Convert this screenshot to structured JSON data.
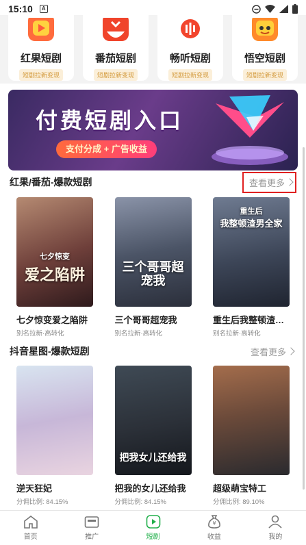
{
  "status": {
    "time": "15:10",
    "app_badge": "A"
  },
  "apps": [
    {
      "name": "红果短剧",
      "tag": "短剧拉新变现",
      "icon": "play-icon",
      "color": "#ff5a3c"
    },
    {
      "name": "番茄短剧",
      "tag": "短剧拉新变现",
      "icon": "tomato-icon",
      "color": "#f0442b"
    },
    {
      "name": "畅听短剧",
      "tag": "短剧拉新变现",
      "icon": "audio-icon",
      "color": "#f2452d"
    },
    {
      "name": "悟空短剧",
      "tag": "短剧拉新变现",
      "icon": "wukong-icon",
      "color": "#ff8a2a"
    }
  ],
  "banner": {
    "title": "付费短剧入口",
    "subtitle": "支付分成 + 广告收益"
  },
  "sections": [
    {
      "title": "红果/番茄-爆款短剧",
      "more": "查看更多",
      "items": [
        {
          "title": "七夕惊变爱之陷阱",
          "sub": "别名拉新·高转化",
          "poster_text": "爱之陷阱",
          "poster_small": "七夕惊变"
        },
        {
          "title": "三个哥哥超宠我",
          "sub": "别名拉新·高转化",
          "poster_text": "三个哥哥超宠我",
          "poster_small": ""
        },
        {
          "title": "重生后我整顿渣男...",
          "sub": "别名拉新·高转化",
          "poster_text": "我整顿渣男全家",
          "poster_small": "重生后"
        }
      ]
    },
    {
      "title": "抖音星图-爆款短剧",
      "more": "查看更多",
      "items": [
        {
          "title": "逆天狂妃",
          "sub": "分佣比例: 84.15%",
          "poster_text": "",
          "poster_small": ""
        },
        {
          "title": "把我的女儿还给我",
          "sub": "分佣比例: 84.15%",
          "poster_text": "把我女儿还给我",
          "poster_small": ""
        },
        {
          "title": "超级萌宝特工",
          "sub": "分佣比例: 89.10%",
          "poster_text": "",
          "poster_small": ""
        }
      ]
    }
  ],
  "nav": [
    {
      "label": "首页",
      "icon": "home-icon",
      "active": false
    },
    {
      "label": "推广",
      "icon": "wallet-icon",
      "active": false
    },
    {
      "label": "短剧",
      "icon": "play-icon",
      "active": true
    },
    {
      "label": "收益",
      "icon": "money-bag-icon",
      "active": false
    },
    {
      "label": "我的",
      "icon": "user-icon",
      "active": false
    }
  ],
  "colors": {
    "accent": "#22b04b",
    "more_highlight": "#e02020",
    "tag_text": "#d39a3c"
  }
}
